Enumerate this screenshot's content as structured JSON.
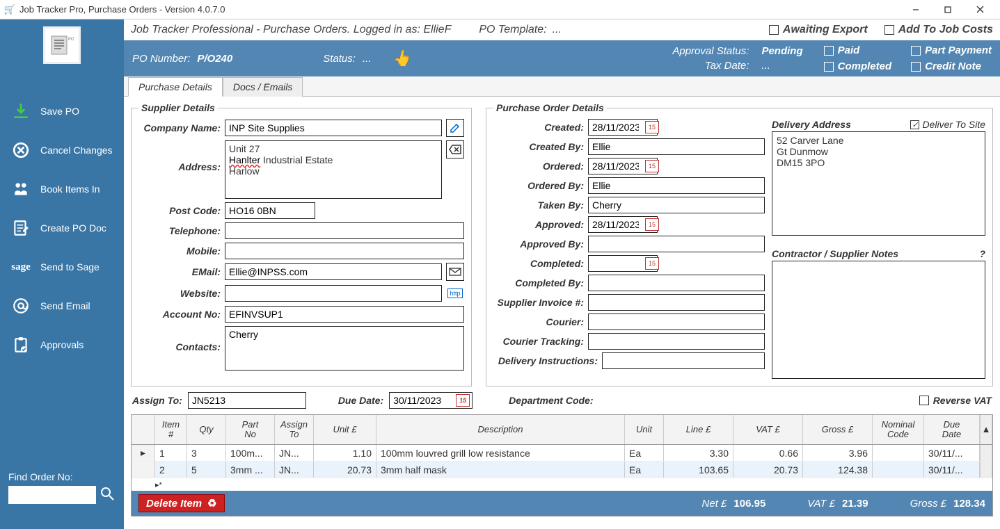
{
  "window": {
    "title": "Job Tracker Pro, Purchase Orders - Version 4.0.7.0"
  },
  "sidebar": {
    "items": [
      {
        "label": "Save PO"
      },
      {
        "label": "Cancel Changes"
      },
      {
        "label": "Book Items In"
      },
      {
        "label": "Create PO Doc"
      },
      {
        "label": "Send to Sage"
      },
      {
        "label": "Send Email"
      },
      {
        "label": "Approvals"
      }
    ],
    "find_label": "Find Order No:",
    "find_value": ""
  },
  "header": {
    "breadcrumb": "Job Tracker Professional - Purchase Orders.  Logged in as: EllieF",
    "po_template_label": "PO Template:",
    "po_template_value": "...",
    "awaiting_export": "Awaiting Export",
    "add_to_job_costs": "Add To Job Costs",
    "add_to_job_costs_checked": false,
    "awaiting_export_checked": false
  },
  "blue": {
    "po_number_label": "PO Number:",
    "po_number": "P/O240",
    "status_label": "Status:",
    "status": "...",
    "approval_status_label": "Approval Status:",
    "approval_status": "Pending",
    "tax_date_label": "Tax Date:",
    "tax_date": "...",
    "checks": {
      "paid": "Paid",
      "part_payment": "Part Payment",
      "completed": "Completed",
      "credit_note": "Credit Note"
    }
  },
  "tabs": {
    "purchase_details": "Purchase Details",
    "docs_emails": "Docs / Emails"
  },
  "supplier": {
    "legend": "Supplier Details",
    "company_label": "Company Name:",
    "company": "INP Site Supplies",
    "address_label": "Address:",
    "address_line1": "Unit 27",
    "address_line2": "Hanlter",
    "address_line2_rest": " Industrial Estate",
    "address_line3": "Harlow",
    "postcode_label": "Post Code:",
    "postcode": "HO16 0BN",
    "telephone_label": "Telephone:",
    "telephone": "",
    "mobile_label": "Mobile:",
    "mobile": "",
    "email_label": "EMail:",
    "email": "Ellie@INPSS.com",
    "website_label": "Website:",
    "website": "",
    "accountno_label": "Account No:",
    "accountno": "EFINVSUP1",
    "contacts_label": "Contacts:",
    "contacts": "Cherry"
  },
  "po": {
    "legend": "Purchase Order Details",
    "created_label": "Created:",
    "created": "28/11/2023",
    "createdby_label": "Created By:",
    "createdby": "Ellie",
    "ordered_label": "Ordered:",
    "ordered": "28/11/2023",
    "orderedby_label": "Ordered By:",
    "orderedby": "Ellie",
    "takenby_label": "Taken By:",
    "takenby": "Cherry",
    "approved_label": "Approved:",
    "approved": "28/11/2023",
    "approvedby_label": "Approved By:",
    "approvedby": "",
    "completed_label": "Completed:",
    "completed": "",
    "completedby_label": "Completed By:",
    "completedby": "",
    "supinv_label": "Supplier Invoice #:",
    "supinv": "",
    "courier_label": "Courier:",
    "courier": "",
    "track_label": "Courier Tracking:",
    "track": "",
    "delinst_label": "Delivery Instructions:",
    "delinst": "",
    "delivery_address_label": "Delivery Address",
    "deliver_to_site_label": "Deliver To Site",
    "deliver_to_site_checked": true,
    "delivery_address": "52 Carver Lane\nGt Dunmow\nDM15 3PO",
    "notes_label": "Contractor / Supplier Notes",
    "notes_help": "?"
  },
  "assign": {
    "assign_to_label": "Assign To:",
    "assign_to": "JN5213",
    "due_date_label": "Due Date:",
    "due_date": "30/11/2023",
    "dept_label": "Department Code:",
    "dept": "",
    "reverse_vat_label": "Reverse VAT",
    "reverse_vat_checked": false
  },
  "grid": {
    "headers": {
      "item": "Item\n#",
      "qty": "Qty",
      "part": "Part\nNo",
      "assign": "Assign\nTo",
      "unit_price": "Unit £",
      "desc": "Description",
      "unit": "Unit",
      "line": "Line £",
      "vat": "VAT £",
      "gross": "Gross £",
      "nominal": "Nominal\nCode",
      "due": "Due\nDate"
    },
    "rows": [
      {
        "item": "1",
        "qty": "3",
        "part": "100m...",
        "assign": "JN...",
        "unit_price": "1.10",
        "desc": "100mm louvred grill low resistance",
        "unit": "Ea",
        "line": "3.30",
        "vat": "0.66",
        "gross": "3.96",
        "nominal": "",
        "due": "30/11/..."
      },
      {
        "item": "2",
        "qty": "5",
        "part": "3mm ...",
        "assign": "JN...",
        "unit_price": "20.73",
        "desc": "3mm half mask",
        "unit": "Ea",
        "line": "103.65",
        "vat": "20.73",
        "gross": "124.38",
        "nominal": "",
        "due": "30/11/..."
      }
    ]
  },
  "footer": {
    "delete": "Delete Item",
    "net_label": "Net £",
    "net": "106.95",
    "vat_label": "VAT £",
    "vat": "21.39",
    "gross_label": "Gross £",
    "gross": "128.34"
  }
}
